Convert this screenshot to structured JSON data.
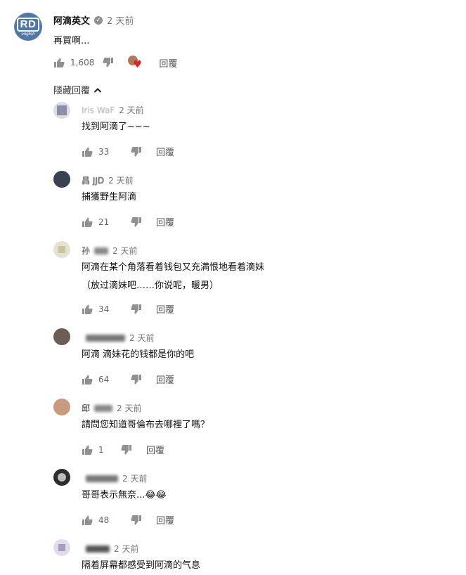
{
  "main_comment": {
    "author": "阿滴英文",
    "time": "2 天前",
    "text": "再買啊...",
    "likes": "1,608",
    "reply_label": "回覆",
    "avatar_text": "RD",
    "avatar_subtext": "english"
  },
  "hide_replies_label": "隱藏回覆",
  "replies": [
    {
      "author": "Iris WaF",
      "time": "2 天前",
      "text": "找到阿滴了~~~",
      "likes": "33",
      "reply_label": "回覆"
    },
    {
      "author": "昌 JJD",
      "time": "2 天前",
      "text": "捕獲野生阿滴",
      "likes": "21",
      "reply_label": "回覆"
    },
    {
      "author": "孙",
      "time": "2 天前",
      "text": "阿滴在某个角落看着钱包又充满恨地看着滴妹",
      "text2": "（放过滴妹吧……你说呢，暖男）",
      "likes": "34",
      "reply_label": "回覆"
    },
    {
      "author": "",
      "time": "2 天前",
      "text": "阿滴 滴妹花的钱都是你的吧",
      "likes": "64",
      "reply_label": "回覆"
    },
    {
      "author": "邱",
      "time": "2 天前",
      "text": "請問您知道哥倫布去哪裡了嗎？",
      "likes": "1",
      "reply_label": "回覆"
    },
    {
      "author": "",
      "time": "2 天前",
      "text": "哥哥表示無奈...😂😂",
      "likes": "48",
      "reply_label": "回覆"
    },
    {
      "author": "",
      "time": "2 天前",
      "text": "隔着屏幕都感受到阿滴的气息"
    }
  ]
}
